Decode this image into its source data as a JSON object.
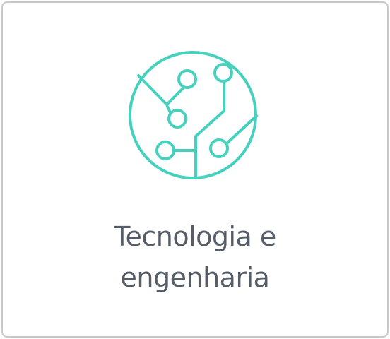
{
  "card": {
    "icon": "technology-circuit-icon",
    "title_line1": "Tecnologia e",
    "title_line2": "engenharia"
  },
  "colors": {
    "accent": "#45d1bd",
    "text": "#555d68",
    "border": "#c8c8c8"
  }
}
